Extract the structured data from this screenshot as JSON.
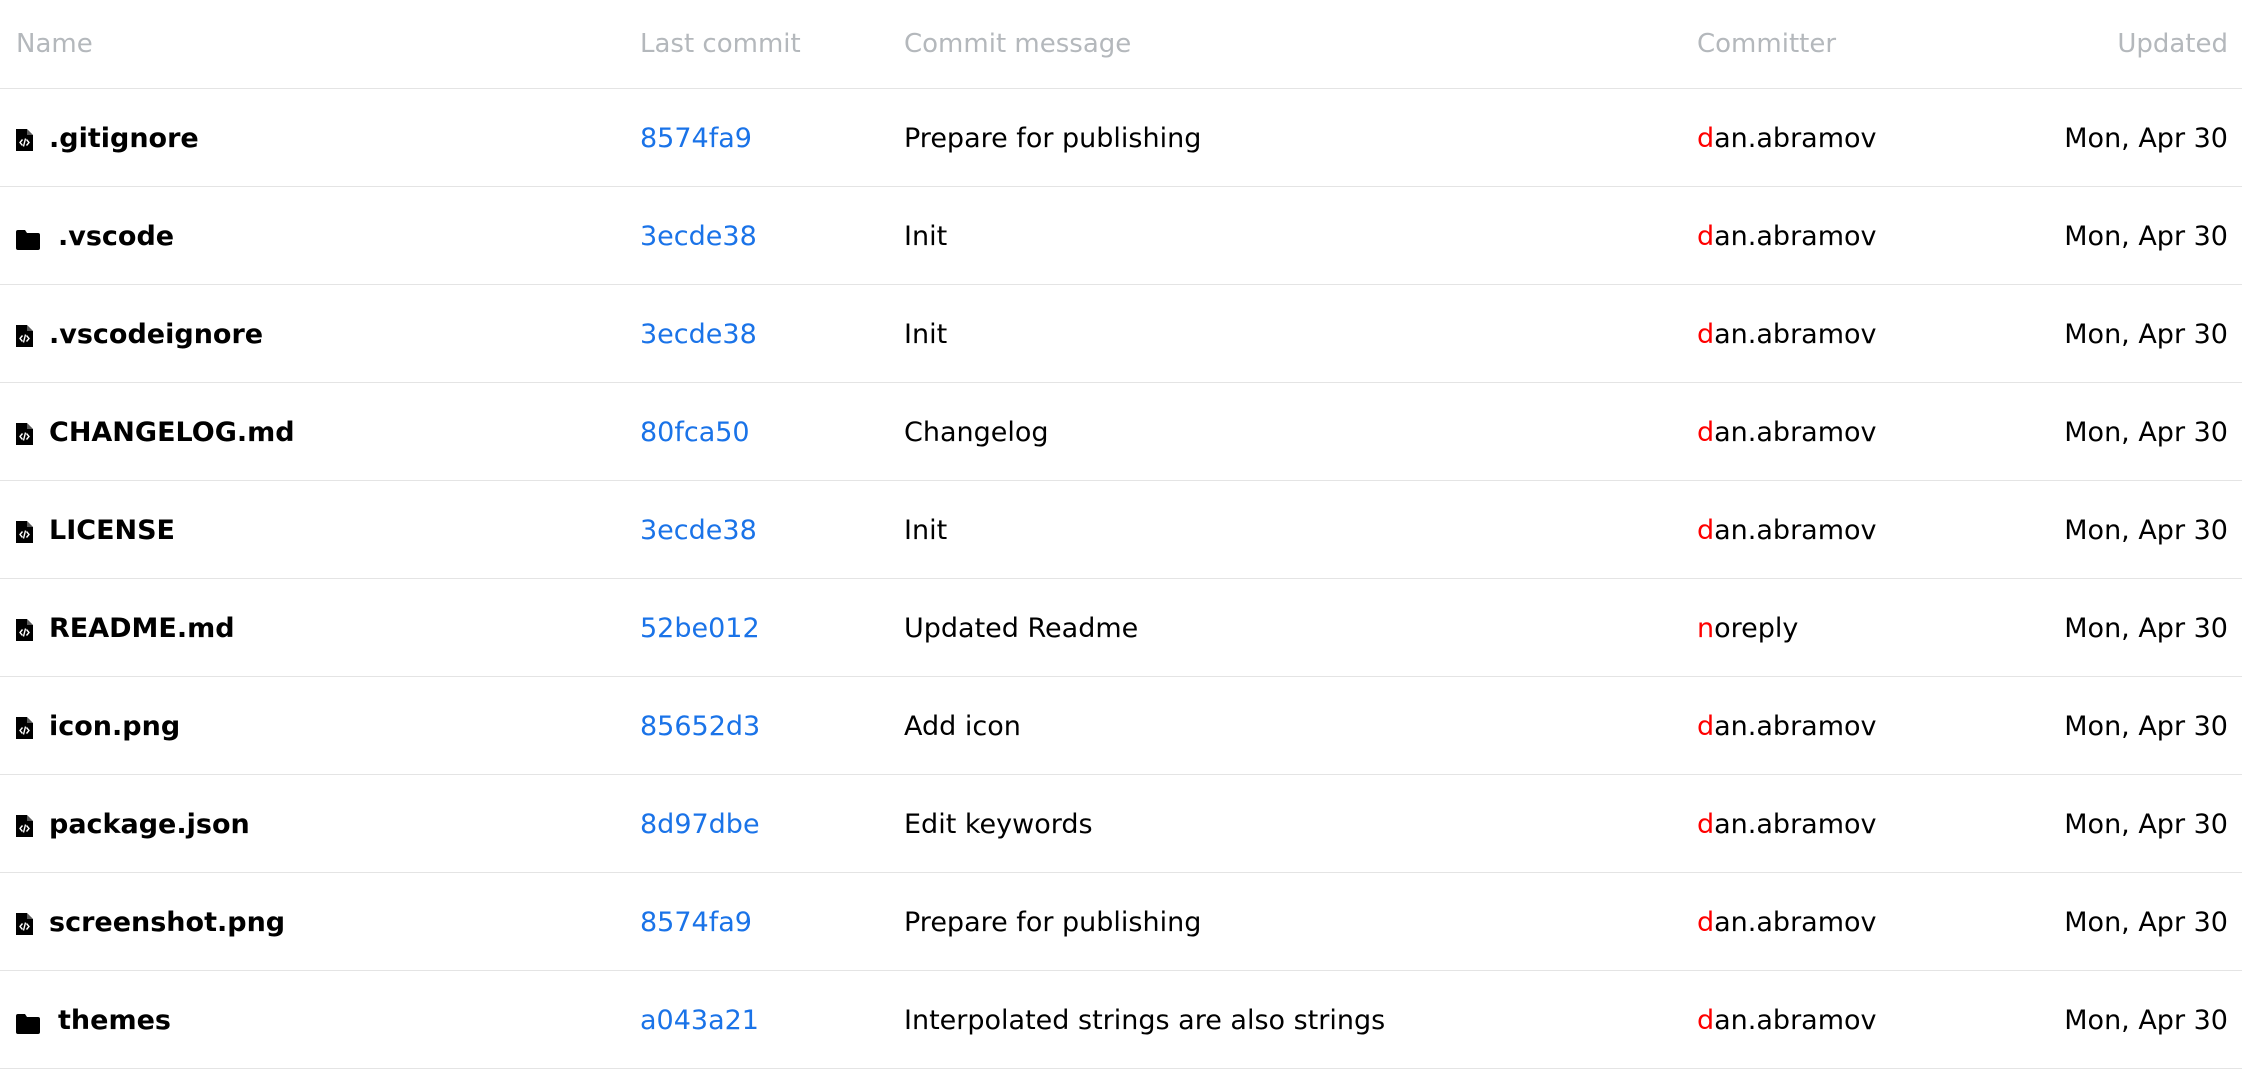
{
  "columns": {
    "name": "Name",
    "last_commit": "Last commit",
    "message": "Commit message",
    "committer": "Committer",
    "updated": "Updated"
  },
  "colors": {
    "link": "#1a73e8",
    "committer_initial": "#ff0000",
    "header_text": "#b4b8bc",
    "divider": "#e4e4e4"
  },
  "rows": [
    {
      "type": "file-icon",
      "name": ".gitignore",
      "commit": "8574fa9",
      "message": "Prepare for publishing",
      "committer_first": "d",
      "committer_rest": "an.abramov",
      "updated": "Mon, Apr 30"
    },
    {
      "type": "folder-icon",
      "name": ".vscode",
      "commit": "3ecde38",
      "message": "Init",
      "committer_first": "d",
      "committer_rest": "an.abramov",
      "updated": "Mon, Apr 30"
    },
    {
      "type": "file-icon",
      "name": ".vscodeignore",
      "commit": "3ecde38",
      "message": "Init",
      "committer_first": "d",
      "committer_rest": "an.abramov",
      "updated": "Mon, Apr 30"
    },
    {
      "type": "file-icon",
      "name": "CHANGELOG.md",
      "commit": "80fca50",
      "message": "Changelog",
      "committer_first": "d",
      "committer_rest": "an.abramov",
      "updated": "Mon, Apr 30"
    },
    {
      "type": "file-icon",
      "name": "LICENSE",
      "commit": "3ecde38",
      "message": "Init",
      "committer_first": "d",
      "committer_rest": "an.abramov",
      "updated": "Mon, Apr 30"
    },
    {
      "type": "file-icon",
      "name": "README.md",
      "commit": "52be012",
      "message": "Updated Readme",
      "committer_first": "n",
      "committer_rest": "oreply",
      "updated": "Mon, Apr 30"
    },
    {
      "type": "file-icon",
      "name": "icon.png",
      "commit": "85652d3",
      "message": "Add icon",
      "committer_first": "d",
      "committer_rest": "an.abramov",
      "updated": "Mon, Apr 30"
    },
    {
      "type": "file-icon",
      "name": "package.json",
      "commit": "8d97dbe",
      "message": "Edit keywords",
      "committer_first": "d",
      "committer_rest": "an.abramov",
      "updated": "Mon, Apr 30"
    },
    {
      "type": "file-icon",
      "name": "screenshot.png",
      "commit": "8574fa9",
      "message": "Prepare for publishing",
      "committer_first": "d",
      "committer_rest": "an.abramov",
      "updated": "Mon, Apr 30"
    },
    {
      "type": "folder-icon",
      "name": "themes",
      "commit": "a043a21",
      "message": "Interpolated strings are also strings",
      "committer_first": "d",
      "committer_rest": "an.abramov",
      "updated": "Mon, Apr 30"
    }
  ]
}
